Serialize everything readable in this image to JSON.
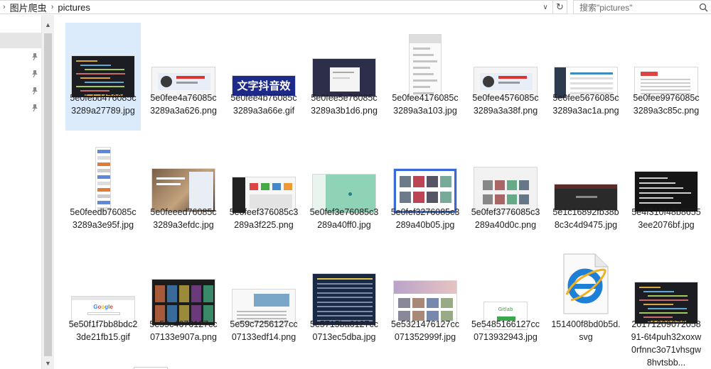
{
  "address_bar": {
    "crumbs": [
      "图片爬虫",
      "pictures"
    ],
    "separator": "›",
    "dropdown_glyph": "∨",
    "refresh_glyph": "↻"
  },
  "search": {
    "placeholder": "搜索\"pictures\"",
    "icon": "search-icon"
  },
  "nav": {
    "pins": 4,
    "icon": "pin-icon"
  },
  "files": [
    {
      "name": "5e0febd476085c3289a27789.jpg",
      "thumb": "code-dark",
      "selected": true
    },
    {
      "name": "5e0fee4a76085c3289a3a626.png",
      "thumb": "web-banner"
    },
    {
      "name": "5e0fee4b76085c3289a3a66e.gif",
      "thumb": "text-effect"
    },
    {
      "name": "5e0fee5e76085c3289a3b1d6.png",
      "thumb": "dark-dialog"
    },
    {
      "name": "5e0fee4176085c3289a3a103.jpg",
      "thumb": "tall-page"
    },
    {
      "name": "5e0fee4576085c3289a3a38f.png",
      "thumb": "web-banner"
    },
    {
      "name": "5e0fee5676085c3289a3ac1a.png",
      "thumb": "admin-panel"
    },
    {
      "name": "5e0fee9976085c3289a3c85c.png",
      "thumb": "form-page"
    },
    {
      "name": "5e0feedb76085c3289a3e95f.jpg",
      "thumb": "long-page"
    },
    {
      "name": "5e0feeed76085c3289a3efdc.jpg",
      "thumb": "desk-photo"
    },
    {
      "name": "5e0feef376085c3289a3f225.png",
      "thumb": "dashboard"
    },
    {
      "name": "5e0fef3e76085c3289a40ff0.jpg",
      "thumb": "green-map"
    },
    {
      "name": "5e0fef3276085c3289a40b05.jpg",
      "thumb": "video-site"
    },
    {
      "name": "5e0fef3776085c3289a40d0c.png",
      "thumb": "gallery-grid"
    },
    {
      "name": "5e1c16892fb38b8c3c4d9475.jpg",
      "thumb": "dark-web"
    },
    {
      "name": "5e4f310f48b86553ee2076bf.jpg",
      "thumb": "terminal"
    },
    {
      "name": "5e50f1f7bb8bdc23de21fb15.gif",
      "thumb": "google"
    },
    {
      "name": "5e59c4676127cc07133e907a.png",
      "thumb": "movie-grid"
    },
    {
      "name": "5e59c7256127cc07133edf14.png",
      "thumb": "blog-page"
    },
    {
      "name": "5e5715ba6127cc0713ec5dba.jpg",
      "thumb": "list-dark"
    },
    {
      "name": "5e5321476127cc071352999f.jpg",
      "thumb": "photo-site"
    },
    {
      "name": "5e5485166127cc0713932943.jpg",
      "thumb": "download-page"
    },
    {
      "name": "151400f8bd0b5d.svg",
      "thumb": "ie-icon"
    },
    {
      "name": "20171209072058 91-6t4puh32xoxw0rfnnc3o71vhsgw8hvtsbb...",
      "thumb": "code-dark"
    }
  ]
}
